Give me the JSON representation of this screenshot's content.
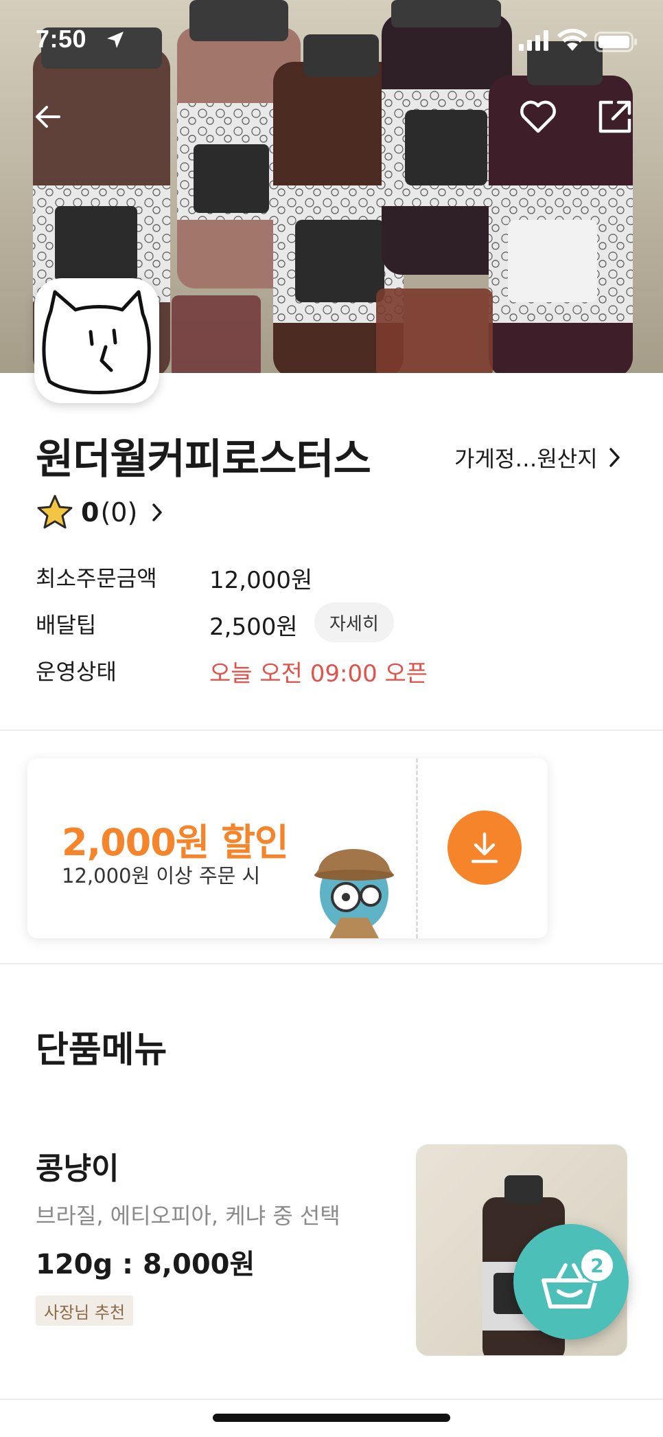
{
  "status_bar": {
    "time": "7:50"
  },
  "store": {
    "name": "원더월커피로스터스",
    "info_link": "가게정…원산지",
    "rating": {
      "score": "0",
      "count": "(0)"
    },
    "details": [
      {
        "label": "최소주문금액",
        "value": "12,000원"
      },
      {
        "label": "배달팁",
        "value": "2,500원",
        "chip": "자세히"
      },
      {
        "label": "운영상태",
        "value": "오늘 오전 09:00 오픈"
      }
    ]
  },
  "coupon": {
    "title": "2,000원 할인",
    "condition": "12,000원 이상 주문 시"
  },
  "menu_section": {
    "title": "단품메뉴",
    "items": [
      {
        "name": "콩냥이",
        "description": "브라질, 에티오피아, 케냐 중 선택",
        "price": "120g : 8,000원",
        "badge": "사장님 추천"
      }
    ]
  },
  "cart": {
    "count": "2"
  },
  "colors": {
    "accent_orange": "#f5842b",
    "status_red": "#e0524a",
    "cart_teal": "#4cbfb8",
    "badge_bg": "#f1ece6",
    "badge_text": "#8b6a48"
  },
  "icons": [
    "back-arrow-icon",
    "heart-icon",
    "share-icon",
    "star-icon",
    "chevron-right-icon",
    "download-icon",
    "cart-basket-icon"
  ]
}
